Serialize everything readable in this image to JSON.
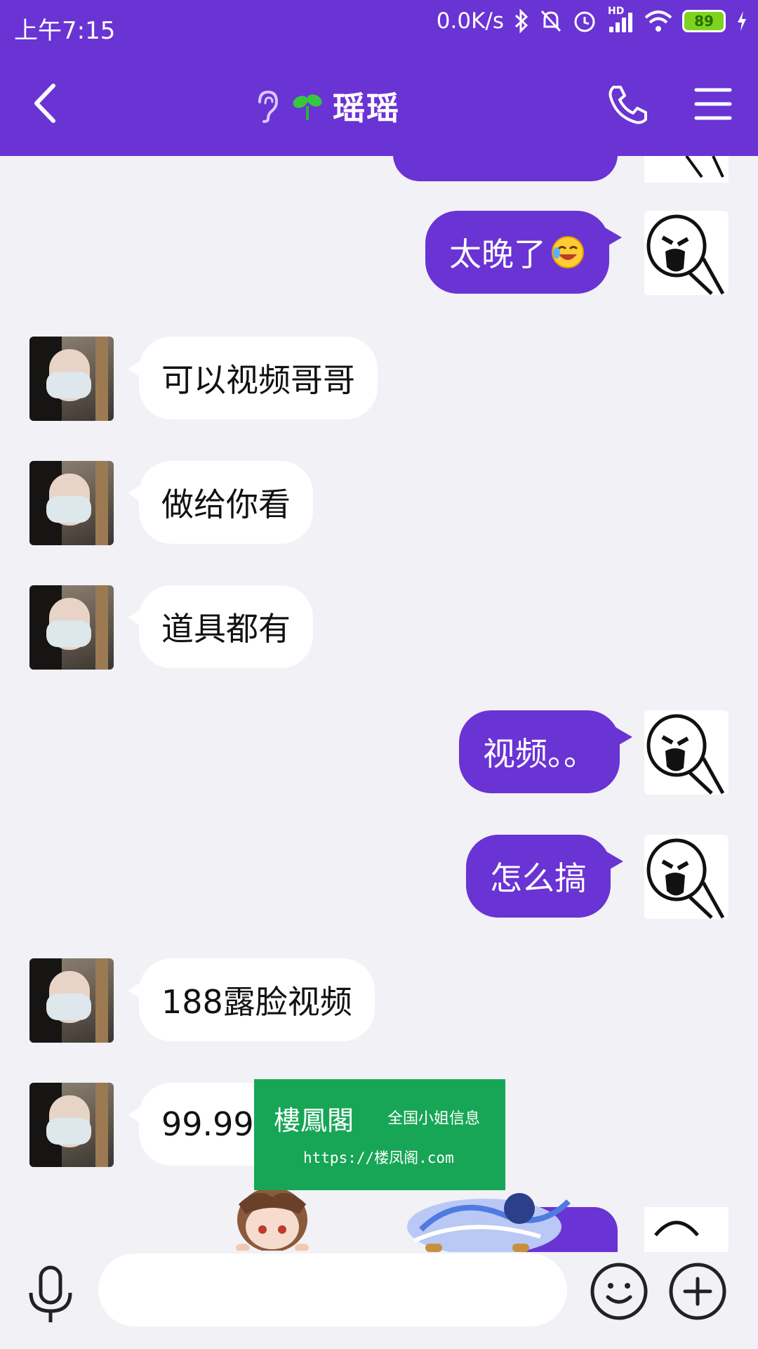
{
  "status_bar": {
    "time": "上午7:15",
    "network_speed": "0.0K/s",
    "signal_badge": "HD",
    "battery": "89"
  },
  "header": {
    "title": "瑶瑶",
    "icons": [
      "back-arrow-icon",
      "ear-icon",
      "sprout-icon",
      "phone-icon",
      "menu-icon"
    ]
  },
  "colors": {
    "accent": "#6a33d4",
    "background": "#f1f1f6",
    "incoming_bubble": "#ffffff",
    "watermark": "#17a656"
  },
  "messages": [
    {
      "side": "out",
      "text": "太晚了"
    },
    {
      "side": "in",
      "text": "可以视频哥哥"
    },
    {
      "side": "in",
      "text": "做给你看"
    },
    {
      "side": "in",
      "text": "道具都有"
    },
    {
      "side": "out",
      "text": "视频。。"
    },
    {
      "side": "out",
      "text": "怎么搞"
    },
    {
      "side": "in",
      "text": "188露脸视频"
    },
    {
      "side": "in",
      "text": "99.99"
    }
  ],
  "watermark": {
    "logo": "樓鳳閣",
    "tagline": "全国小姐信息",
    "url": "https://楼凤阁.com"
  },
  "input_bar": {
    "placeholder": ""
  }
}
